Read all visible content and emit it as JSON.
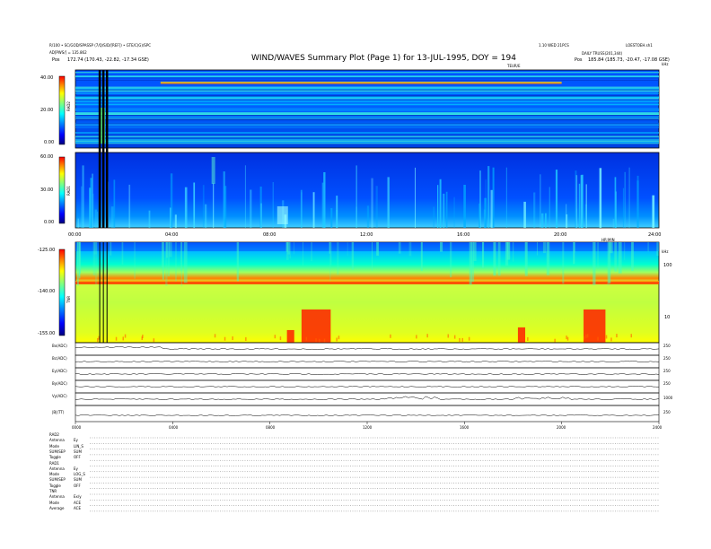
{
  "header": {
    "title": "WIND/WAVES Summary Plot (Page 1) for 13-JUL-1995, DOY = 194",
    "left_line1": "R/100 • SC/GOD/SPASSP (7/Q/S/D/[REF]) • GTE/C(G)/SPC",
    "left_line2": "AD[PWS/] = 135.862",
    "left_pos_label": "Pos",
    "left_pos_value": "172.74 (170.43, -22.82, -17.34 GSE)",
    "right_line1": "1.10 WED 21PCS",
    "right_line1b": "LOESTOEH.sh1",
    "right_line2": "DAILY TRUSS(201,344)",
    "right_pos_label": "Pos",
    "right_pos_value": "185.84 (185.73, -20.47, -17.08 GSE)",
    "top_units": "TEUR/E",
    "top_right_unit": "kHz"
  },
  "panels": {
    "rad2": {
      "label": "RAD2",
      "ticks": [
        "40.00",
        "20.00",
        "0.00"
      ]
    },
    "rad1": {
      "label": "RAD1",
      "ticks": [
        "60.00",
        "30.00",
        "0.00"
      ]
    },
    "tnr": {
      "label": "TNR",
      "ticks": [
        "-125.00",
        "-140.00",
        "-155.00"
      ],
      "right_ticks": [
        "100",
        "10"
      ],
      "right_unit": "kHz"
    },
    "time_axis_top": [
      "00:00",
      "04:00",
      "08:00",
      "12:00",
      "16:00",
      "20:00",
      "24:00"
    ],
    "time_axis_bottom": [
      "0000",
      "0400",
      "0800",
      "1200",
      "1600",
      "2000",
      "2400"
    ],
    "time_unit": "HR:MIN",
    "traces": [
      {
        "label": "Bx(ADC)",
        "right": "250"
      },
      {
        "label": "Bc(ADC)",
        "right": "250"
      },
      {
        "label": "Ey(ADC)",
        "right": "250"
      },
      {
        "label": "By(ADC)",
        "right": "250"
      },
      {
        "label": "Vy(ADC)",
        "right": "1000"
      },
      {
        "label": "|B|(TT)",
        "right": "250"
      }
    ]
  },
  "footer": {
    "rows": [
      {
        "k": "RAD2",
        "v": ""
      },
      {
        "k": "Antenna",
        "v": "Ey"
      },
      {
        "k": "Mode",
        "v": "LIN_S"
      },
      {
        "k": "SUM/SEP",
        "v": "SUM"
      },
      {
        "k": "Toggle",
        "v": "OFF"
      },
      {
        "k": "RAD1",
        "v": ""
      },
      {
        "k": "Antenna",
        "v": "Ey"
      },
      {
        "k": "Mode",
        "v": "LOG_S"
      },
      {
        "k": "SUM/SEP",
        "v": "SUM"
      },
      {
        "k": "Toggle",
        "v": "OFF"
      },
      {
        "k": "TNR",
        "v": ""
      },
      {
        "k": "Antenna",
        "v": "Ex/y"
      },
      {
        "k": "Mode",
        "v": "ACE"
      },
      {
        "k": "Average",
        "v": "ACE"
      }
    ]
  },
  "chart_data": {
    "type": "heatmap",
    "title": "WIND/WAVES Summary Plot (Page 1) for 13-JUL-1995, DOY = 194",
    "x_range_hours": [
      0,
      24
    ],
    "colorscale": [
      "#00007f",
      "#0000ff",
      "#0080ff",
      "#00ffff",
      "#80ff80",
      "#ffff00",
      "#ff8000",
      "#ff0000"
    ],
    "series": [
      {
        "name": "RAD2",
        "ylim": [
          0,
          40
        ]
      },
      {
        "name": "RAD1",
        "ylim": [
          0,
          60
        ]
      },
      {
        "name": "TNR",
        "ylim": [
          -155,
          -125
        ]
      }
    ],
    "marker_lines_hours": [
      1.0,
      1.15,
      1.3
    ]
  }
}
